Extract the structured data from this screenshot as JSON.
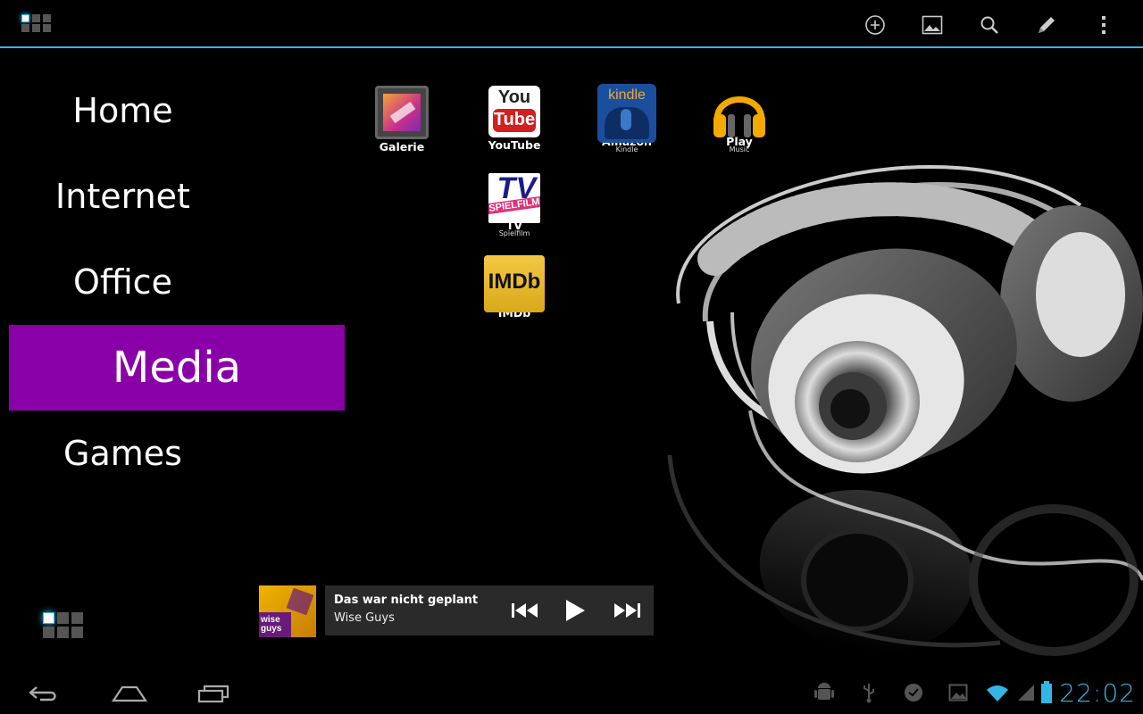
{
  "topbar": {
    "actions": [
      {
        "icon": "add-circle-icon"
      },
      {
        "icon": "wallpaper-icon"
      },
      {
        "icon": "search-icon"
      },
      {
        "icon": "edit-pencil-icon"
      },
      {
        "icon": "overflow-menu-icon"
      }
    ]
  },
  "nav": {
    "items": [
      {
        "label": "Home",
        "selected": false
      },
      {
        "label": "Internet",
        "selected": false
      },
      {
        "label": "Office",
        "selected": false
      },
      {
        "label": "Media",
        "selected": true
      },
      {
        "label": "Games",
        "selected": false
      }
    ],
    "selected_color": "#8a00a8"
  },
  "apps": [
    {
      "label": "Galerie",
      "sublabel": "",
      "icon": "gallery-icon"
    },
    {
      "label": "YouTube",
      "sublabel": "",
      "icon": "youtube-icon",
      "icon_text_top": "You",
      "icon_text_bottom": "Tube"
    },
    {
      "label": "Amazon",
      "sublabel": "Kindle",
      "icon": "kindle-icon",
      "icon_text": "kindle"
    },
    {
      "label": "Play",
      "sublabel": "Music",
      "icon": "play-music-icon"
    },
    {
      "label": "TV",
      "sublabel": "Spielfilm",
      "icon": "tv-spielfilm-icon",
      "icon_text_top": "TV",
      "icon_text_bottom": "SPIELFILM"
    },
    {
      "label": "IMDb",
      "sublabel": "",
      "icon": "imdb-icon",
      "icon_text": "IMDb"
    }
  ],
  "player": {
    "title": "Das war nicht geplant",
    "artist": "Wise Guys",
    "album_text": "wise guys",
    "controls": [
      "previous-icon",
      "play-icon",
      "next-icon"
    ]
  },
  "sysbar": {
    "clock": "22:02",
    "battery_text": "91",
    "accent": "#33b5e5"
  }
}
